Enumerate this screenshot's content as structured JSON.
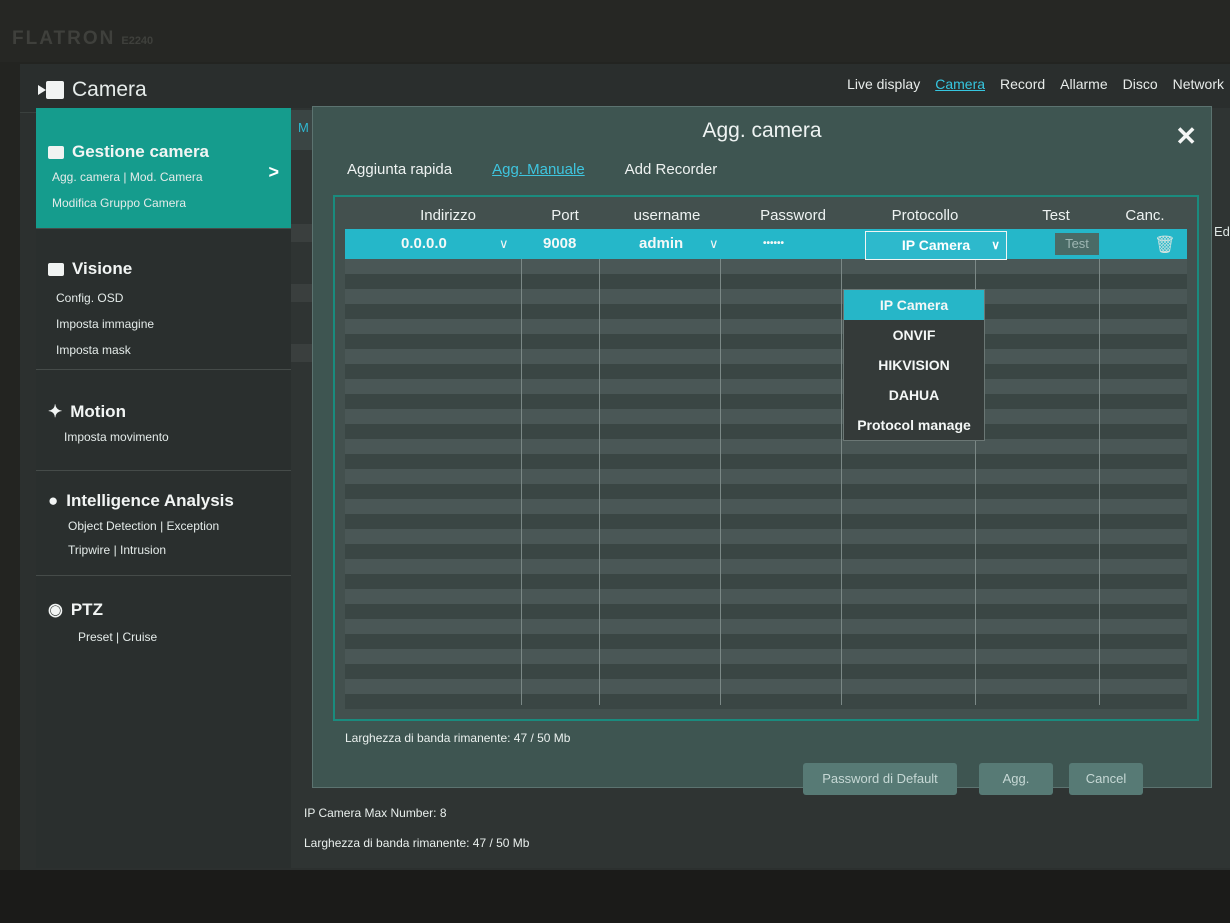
{
  "monitor": {
    "brand": "FLATRON",
    "model": "E2240"
  },
  "app": {
    "title": "Camera"
  },
  "topnav": [
    {
      "label": "Live display",
      "active": false
    },
    {
      "label": "Camera",
      "active": true
    },
    {
      "label": "Record",
      "active": false
    },
    {
      "label": "Allarme",
      "active": false
    },
    {
      "label": "Disco",
      "active": false
    },
    {
      "label": "Network",
      "active": false
    }
  ],
  "sidebar": {
    "gestione": {
      "title": "Gestione camera",
      "sub1": "Agg. camera",
      "sub2": "Mod. Camera",
      "sub3": "Modifica Gruppo Camera"
    },
    "visione": {
      "title": "Visione",
      "sub1": "Config. OSD",
      "sub2": "Imposta immagine",
      "sub3": "Imposta mask"
    },
    "motion": {
      "title": "Motion",
      "sub1": "Imposta movimento"
    },
    "intelligence": {
      "title": "Intelligence Analysis",
      "sub1": "Object Detection",
      "sub2": "Exception",
      "sub3": "Tripwire",
      "sub4": "Intrusion"
    },
    "ptz": {
      "title": "PTZ",
      "sub1": "Preset",
      "sub2": "Cruise"
    },
    "separator": "|"
  },
  "background": {
    "tab_label": "M",
    "bottom_line1": "IP Camera Max Number: 8",
    "bottom_line2": "Larghezza di banda rimanente: 47 / 50 Mb",
    "right_label": "Ed"
  },
  "dialog": {
    "title": "Agg. camera",
    "close": "✕",
    "tabs": [
      {
        "label": "Aggiunta rapida",
        "active": false
      },
      {
        "label": "Agg. Manuale",
        "active": true
      },
      {
        "label": "Add Recorder",
        "active": false
      }
    ],
    "columns": [
      "Indirizzo",
      "Port",
      "username",
      "Password",
      "Protocollo",
      "Test",
      "Canc."
    ],
    "row": {
      "address": "0.0.0.0",
      "port": "9008",
      "username": "admin",
      "password": "••••••",
      "protocol": "IP Camera",
      "test": "Test"
    },
    "protocol_options": [
      "IP Camera",
      "ONVIF",
      "HIKVISION",
      "DAHUA",
      "Protocol manage"
    ],
    "selected_protocol_index": 0,
    "bandwidth": "Larghezza di banda rimanente: 47 / 50 Mb",
    "buttons": {
      "default_password": "Password di Default",
      "add": "Agg.",
      "cancel": "Cancel"
    }
  },
  "colors": {
    "accent": "#159c8d",
    "selection": "#25b7c9",
    "link": "#36c6e0"
  }
}
